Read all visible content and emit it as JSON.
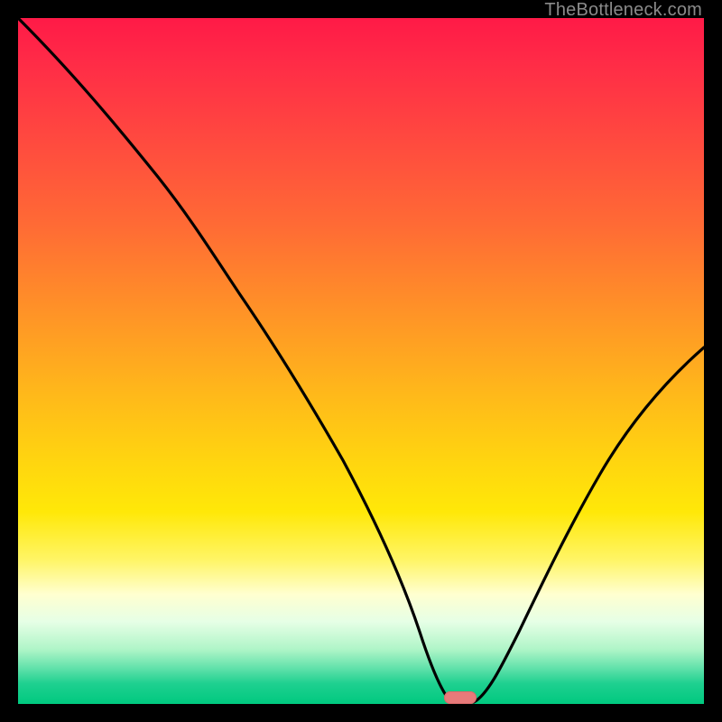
{
  "watermark": "TheBottleneck.com",
  "colors": {
    "background": "#000000",
    "curve": "#000000",
    "marker": "#e77a7a",
    "gradient_top": "#ff1a47",
    "gradient_bottom": "#00c97f"
  },
  "chart_data": {
    "type": "line",
    "title": "",
    "xlabel": "",
    "ylabel": "",
    "xlim": [
      0,
      100
    ],
    "ylim": [
      0,
      100
    ],
    "grid": false,
    "legend": false,
    "marker": {
      "x": 64,
      "y": 0,
      "shape": "pill",
      "color": "#e77a7a"
    },
    "series": [
      {
        "name": "bottleneck-curve",
        "x": [
          0,
          5,
          10,
          15,
          20,
          25,
          30,
          35,
          40,
          45,
          50,
          55,
          58,
          61,
          63,
          66,
          69,
          72,
          76,
          80,
          85,
          90,
          95,
          100
        ],
        "values": [
          100,
          94,
          88,
          82,
          76,
          71,
          64,
          56,
          48,
          39,
          30,
          19,
          10,
          3,
          0,
          0,
          3,
          8,
          15,
          22,
          30,
          38,
          45,
          52
        ]
      }
    ]
  }
}
